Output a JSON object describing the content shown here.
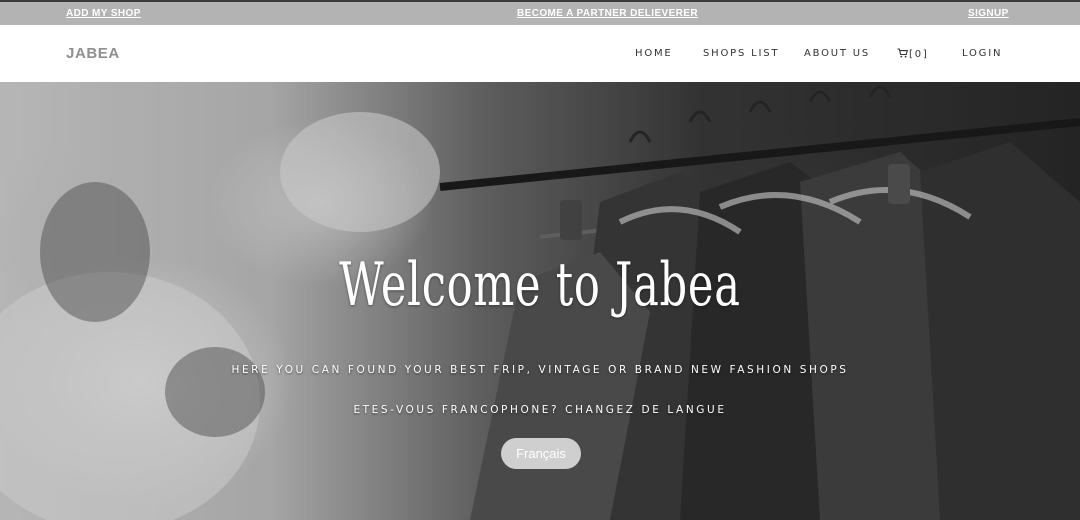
{
  "topbar": {
    "add_shop": "ADD MY SHOP",
    "become_partner": "BECOME A PARTNER DELIEVERER",
    "signup": "SIGNUP"
  },
  "navbar": {
    "brand": "JABEA",
    "links": {
      "home": "HOME",
      "shops_list": "SHOPS LIST",
      "about_us": "ABOUT US",
      "cart": "[0]",
      "login": "LOGIN"
    },
    "cart_icon": "cart-icon"
  },
  "hero": {
    "title": "Welcome to Jabea",
    "subtitle": "HERE YOU CAN FOUND YOUR BEST FRIP, VINTAGE OR BRAND NEW FASHION SHOPS",
    "language_prompt": "ETES-VOUS FRANCOPHONE? CHANGEZ DE LANGUE",
    "language_button": "Français"
  },
  "colors": {
    "topbar_bg": "#b3b3b3",
    "brand": "#8f8f8f",
    "hero_text": "#ffffff"
  }
}
